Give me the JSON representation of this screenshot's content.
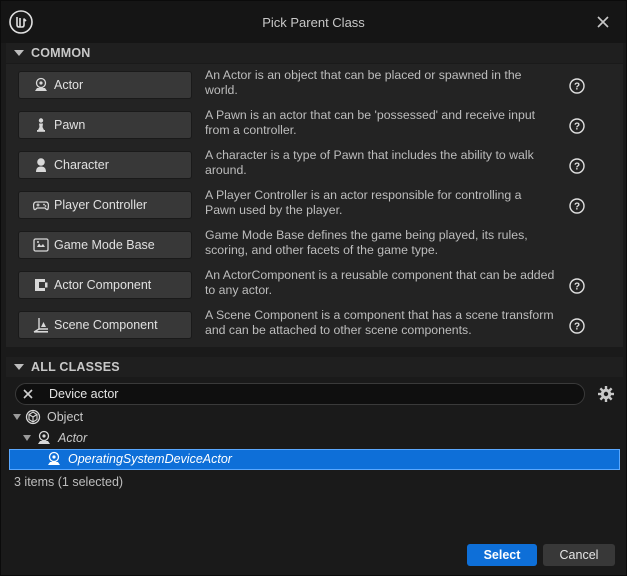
{
  "window": {
    "title": "Pick Parent Class"
  },
  "common": {
    "header": "COMMON",
    "items": [
      {
        "label": "Actor",
        "icon": "actor-icon",
        "description": "An Actor is an object that can be placed or spawned in the world."
      },
      {
        "label": "Pawn",
        "icon": "pawn-icon",
        "description": "A Pawn is an actor that can be 'possessed' and receive input from a controller."
      },
      {
        "label": "Character",
        "icon": "character-icon",
        "description": "A character is a type of Pawn that includes the ability to walk around."
      },
      {
        "label": "Player Controller",
        "icon": "gamepad-icon",
        "description": "A Player Controller is an actor responsible for controlling a Pawn used by the player."
      },
      {
        "label": "Game Mode Base",
        "icon": "game-mode-icon",
        "description": "Game Mode Base defines the game being played, its rules, scoring, and other facets of the game type."
      },
      {
        "label": "Actor Component",
        "icon": "component-icon",
        "description": "An ActorComponent is a reusable component that can be added to any actor."
      },
      {
        "label": "Scene Component",
        "icon": "scene-component-icon",
        "description": "A Scene Component is a component that has a scene transform and can be attached to other scene components."
      }
    ]
  },
  "all_classes": {
    "header": "ALL CLASSES",
    "search_value": "Device actor",
    "tree": [
      {
        "label": "Object",
        "icon": "object-icon",
        "italic": false
      },
      {
        "label": "Actor",
        "icon": "actor-icon",
        "italic": true
      },
      {
        "label": "OperatingSystemDeviceActor",
        "icon": "actor-icon",
        "italic": true,
        "selected": true
      }
    ],
    "status": "3 items (1 selected)"
  },
  "footer": {
    "select_label": "Select",
    "cancel_label": "Cancel"
  },
  "colors": {
    "accent": "#0e6fd8",
    "background": "#1a1a1a",
    "panel": "#232323",
    "button": "#383838"
  }
}
